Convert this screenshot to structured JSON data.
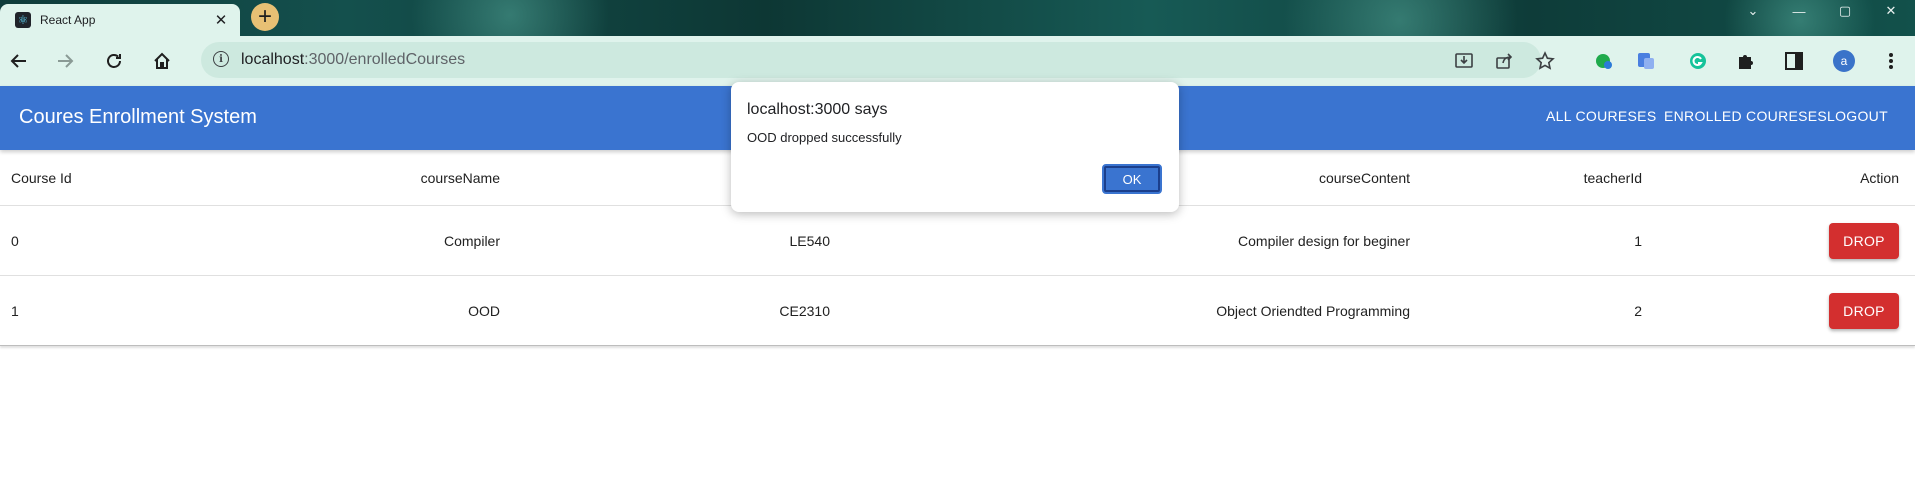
{
  "browser": {
    "tab_title": "React App",
    "tab_close": "✕",
    "new_tab": "+",
    "window_controls": {
      "minimize": "—",
      "maximize": "▢",
      "close": "✕",
      "menu": "⌄"
    },
    "url_host": "localhost",
    "url_path": ":3000/enrolledCourses",
    "avatar_letter": "a",
    "colors": {
      "tab_strip": "#14504d",
      "toolbar": "#dff3ec",
      "omnibox": "#cde9df"
    }
  },
  "app": {
    "title": "Coures Enrollment System",
    "nav": {
      "all_courses": "ALL COURESES",
      "enrolled_courses": "ENROLLED COURESES",
      "logout": "LOGOUT"
    },
    "colors": {
      "header": "#3a74d0",
      "drop_button": "#d32f2f"
    }
  },
  "table": {
    "headers": {
      "course_id": "Course Id",
      "course_name": "courseName",
      "course_code": "",
      "course_content": "courseContent",
      "teacher_id": "teacherId",
      "action": "Action"
    },
    "rows": [
      {
        "course_id": "0",
        "course_name": "Compiler",
        "course_code": "LE540",
        "course_content": "Compiler design for beginer",
        "teacher_id": "1",
        "action": "DROP"
      },
      {
        "course_id": "1",
        "course_name": "OOD",
        "course_code": "CE2310",
        "course_content": "Object Oriendted Programming",
        "teacher_id": "2",
        "action": "DROP"
      }
    ]
  },
  "dialog": {
    "title": "localhost:3000 says",
    "message": "OOD dropped successfully",
    "ok_label": "OK"
  }
}
